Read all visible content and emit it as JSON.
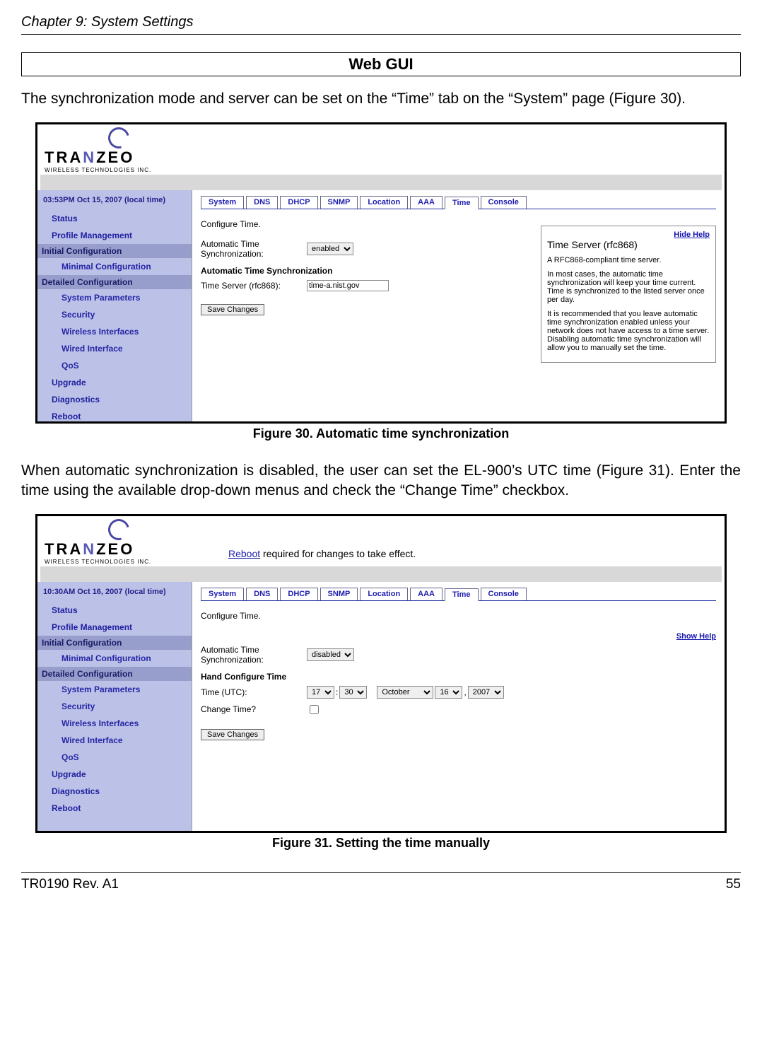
{
  "chapter_header": "Chapter 9: System Settings",
  "section_title": "Web GUI",
  "para1": "The synchronization mode and server can be set on the “Time” tab on the “System” page (Figure 30).",
  "para2": "When automatic synchronization is disabled, the user can set the EL-900’s UTC time (Figure 31). Enter the time using the available drop-down menus and check the “Change Time” checkbox.",
  "fig30_caption": "Figure 30. Automatic time synchronization",
  "fig31_caption": "Figure 31. Setting the time manually",
  "logo": {
    "line1a": "TRA",
    "line1b": "N",
    "line1c": "ZEO",
    "line2": "WIRELESS TECHNOLOGIES INC."
  },
  "tabs": [
    "System",
    "DNS",
    "DHCP",
    "SNMP",
    "Location",
    "AAA",
    "Time",
    "Console"
  ],
  "sidebar": {
    "items_top": [
      "Status",
      "Profile Management"
    ],
    "hdr1": "Initial Configuration",
    "sub1": [
      "Minimal Configuration"
    ],
    "hdr2": "Detailed Configuration",
    "sub2": [
      "System Parameters",
      "Security",
      "Wireless Interfaces",
      "Wired Interface",
      "QoS"
    ],
    "items_bottom": [
      "Upgrade",
      "Diagnostics",
      "Reboot"
    ]
  },
  "fig30": {
    "time": "03:53PM Oct 15, 2007 (local time)",
    "cfg_title": "Configure Time.",
    "auto_label": "Automatic Time Synchronization:",
    "auto_value": "enabled",
    "sync_hdr": "Automatic Time Synchronization",
    "server_label": "Time Server (rfc868):",
    "server_value": "time-a.nist.gov",
    "save": "Save Changes",
    "help": {
      "hide": "Hide Help",
      "title": "Time Server (rfc868)",
      "p1": "A RFC868-compliant time server.",
      "p2": "In most cases, the automatic time synchronization will keep your time current. Time is synchronized to the listed server once per day.",
      "p3": "It is recommended that you leave automatic time synchronization enabled unless your network does not have access to a time server. Disabling automatic time synchronization will allow you to manually set the time."
    }
  },
  "fig31": {
    "time": "10:30AM Oct 16, 2007 (local time)",
    "reboot_word": "Reboot",
    "reboot_rest": " required for changes to take effect.",
    "cfg_title": "Configure Time.",
    "show_help": "Show Help",
    "auto_label": "Automatic Time Synchronization:",
    "auto_value": "disabled",
    "hand_hdr": "Hand Configure Time",
    "time_label": "Time (UTC):",
    "hh": "17",
    "mm": "30",
    "month": "October",
    "day": "16",
    "year": "2007",
    "change_label": "Change Time?",
    "save": "Save Changes"
  },
  "footer_left": "TR0190 Rev. A1",
  "footer_right": "55"
}
